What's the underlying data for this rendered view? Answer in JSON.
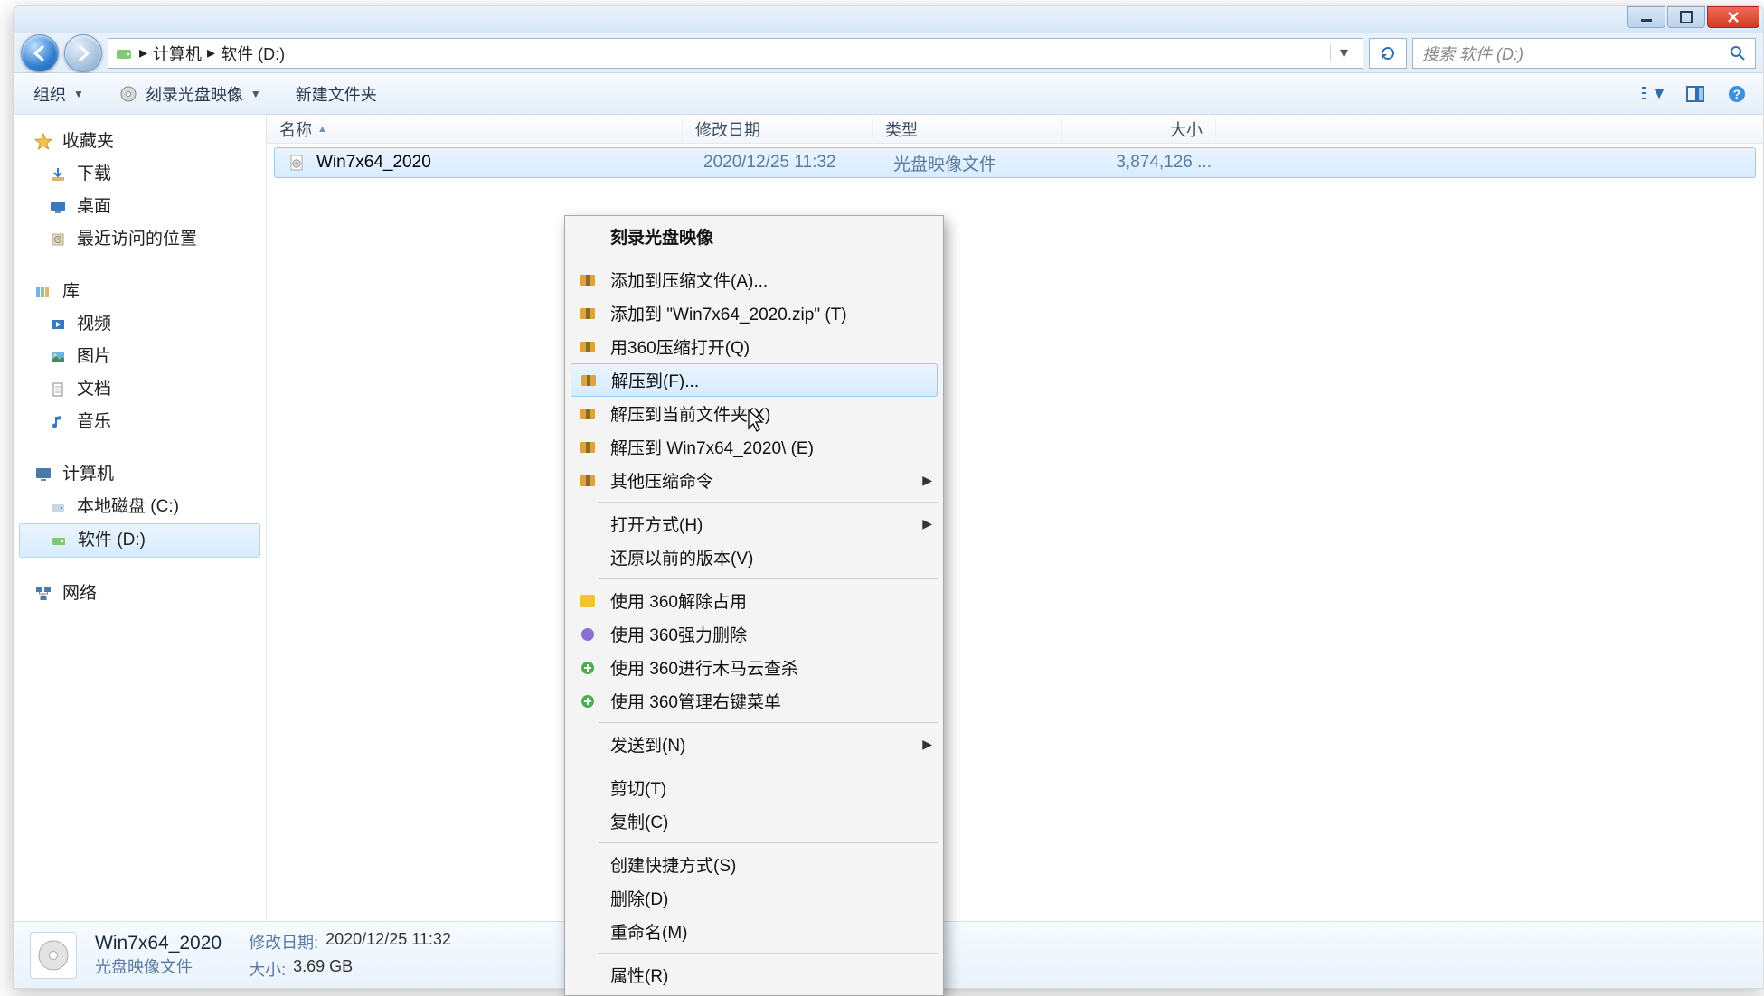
{
  "window": {
    "breadcrumb": {
      "root": "计算机",
      "folder": "软件 (D:)",
      "sep": "▸"
    },
    "search_placeholder": "搜索 软件 (D:)"
  },
  "toolbar": {
    "organize": "组织",
    "burn": "刻录光盘映像",
    "newfolder": "新建文件夹"
  },
  "sidebar": {
    "favorites": {
      "label": "收藏夹",
      "items": [
        "下载",
        "桌面",
        "最近访问的位置"
      ]
    },
    "libraries": {
      "label": "库",
      "items": [
        "视频",
        "图片",
        "文档",
        "音乐"
      ]
    },
    "computer": {
      "label": "计算机",
      "items": [
        "本地磁盘 (C:)",
        "软件 (D:)"
      ]
    },
    "network": {
      "label": "网络"
    }
  },
  "columns": {
    "name": "名称",
    "date": "修改日期",
    "type": "类型",
    "size": "大小"
  },
  "file": {
    "name": "Win7x64_2020",
    "date": "2020/12/25 11:32",
    "type": "光盘映像文件",
    "size": "3,874,126 ..."
  },
  "context_menu": {
    "items": [
      {
        "label": "刻录光盘映像",
        "bold": true,
        "icon": ""
      },
      {
        "sep": true
      },
      {
        "label": "添加到压缩文件(A)...",
        "icon": "archive"
      },
      {
        "label": "添加到 \"Win7x64_2020.zip\" (T)",
        "icon": "archive"
      },
      {
        "label": "用360压缩打开(Q)",
        "icon": "archive"
      },
      {
        "label": "解压到(F)...",
        "icon": "archive",
        "hover": true
      },
      {
        "label": "解压到当前文件夹(X)",
        "icon": "archive"
      },
      {
        "label": "解压到 Win7x64_2020\\ (E)",
        "icon": "archive"
      },
      {
        "label": "其他压缩命令",
        "icon": "archive",
        "submenu": true
      },
      {
        "sep": true
      },
      {
        "label": "打开方式(H)",
        "submenu": true
      },
      {
        "label": "还原以前的版本(V)"
      },
      {
        "sep": true
      },
      {
        "label": "使用 360解除占用",
        "icon": "360y"
      },
      {
        "label": "使用 360强力删除",
        "icon": "360p"
      },
      {
        "label": "使用 360进行木马云查杀",
        "icon": "360g"
      },
      {
        "label": "使用 360管理右键菜单",
        "icon": "360g"
      },
      {
        "sep": true
      },
      {
        "label": "发送到(N)",
        "submenu": true
      },
      {
        "sep": true
      },
      {
        "label": "剪切(T)"
      },
      {
        "label": "复制(C)"
      },
      {
        "sep": true
      },
      {
        "label": "创建快捷方式(S)"
      },
      {
        "label": "删除(D)"
      },
      {
        "label": "重命名(M)"
      },
      {
        "sep": true
      },
      {
        "label": "属性(R)"
      }
    ]
  },
  "details": {
    "name": "Win7x64_2020",
    "type": "光盘映像文件",
    "date_label": "修改日期:",
    "date": "2020/12/25 11:32",
    "size_label": "大小:",
    "size": "3.69 GB"
  },
  "icons": {
    "archive_color": "#e0a23a",
    "360y": "#f4c430",
    "360p": "#8a6fd6",
    "360g": "#48b14c"
  }
}
